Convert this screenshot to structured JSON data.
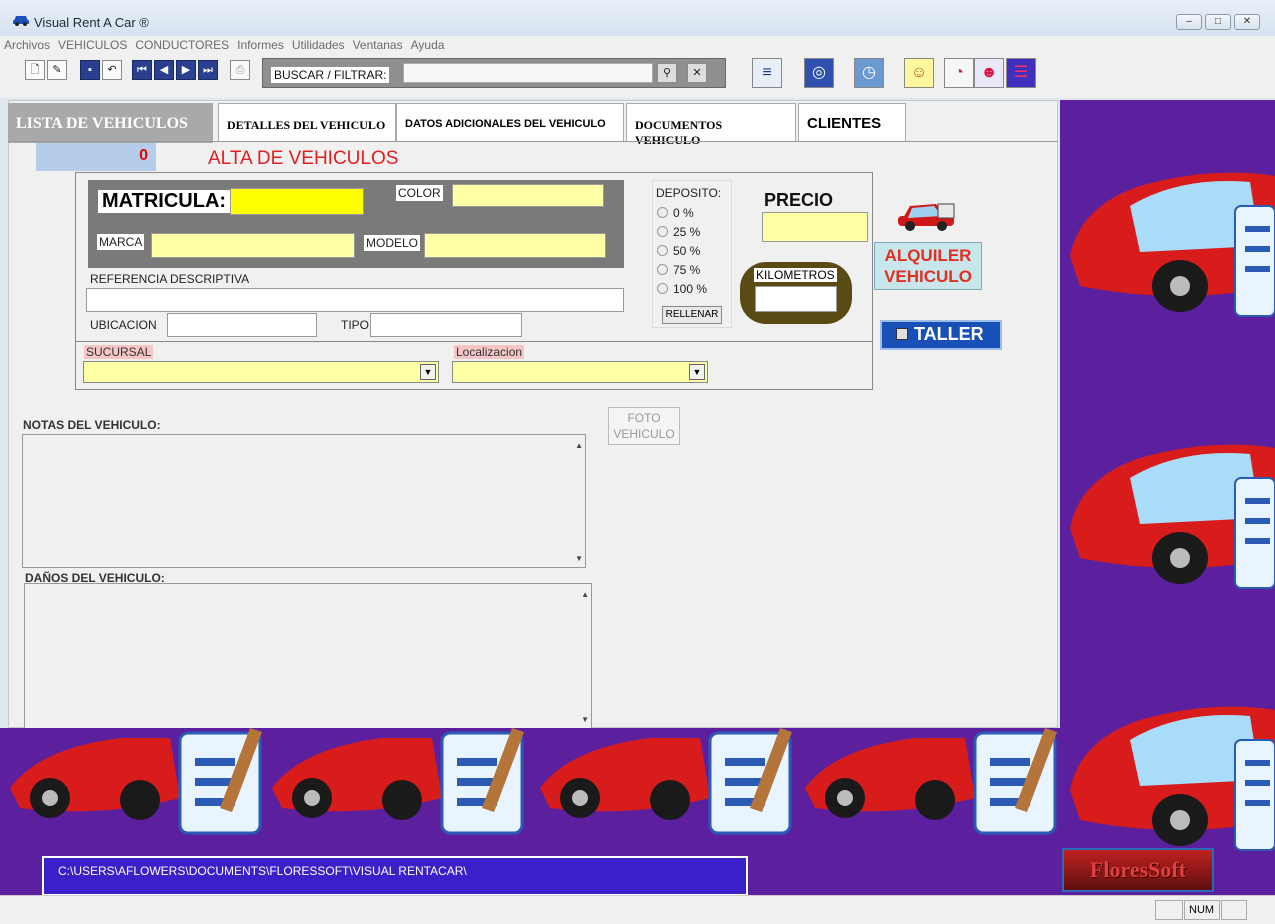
{
  "window": {
    "title": "Visual Rent A Car ®"
  },
  "menu": [
    "Archivos",
    "VEHICULOS",
    "CONDUCTORES",
    "Informes",
    "Utilidades",
    "Ventanas",
    "Ayuda"
  ],
  "toolbar": {
    "search_label": "BUSCAR / FILTRAR:",
    "search_value": ""
  },
  "tabs": {
    "list": "LISTA DE VEHICULOS",
    "details": "DETALLES DEL VEHICULO",
    "extra": "DATOS ADICIONALES DEL VEHICULO",
    "docs": "DOCUMENTOS VEHICULO",
    "clients": "CLIENTES"
  },
  "header": {
    "counter": "0",
    "mode_title": "ALTA DE VEHICULOS"
  },
  "form": {
    "matricula_label": "MATRICULA:",
    "color_label": "COLOR",
    "marca_label": "MARCA",
    "modelo_label": "MODELO",
    "referencia_label": "REFERENCIA DESCRIPTIVA",
    "ubicacion_label": "UBICACION",
    "tipo_label": "TIPO",
    "sucursal_label": "SUCURSAL",
    "localizacion_label": "Localizacion",
    "deposito_label": "DEPOSITO:",
    "deposito_options": [
      "0 %",
      "25 %",
      "50 %",
      "75 %",
      "100 %"
    ],
    "rellenar_label": "RELLENAR",
    "precio_label": "PRECIO",
    "kilometros_label": "KILOMETROS",
    "alquiler_line1": "ALQUILER",
    "alquiler_line2": "VEHICULO",
    "taller_label": "TALLER",
    "foto_line1": "FOTO",
    "foto_line2": "VEHICULO",
    "notas_label": "NOTAS DEL VEHICULO:",
    "danos_label": "DAÑOS DEL VEHICULO:"
  },
  "footer": {
    "path": "C:\\USERS\\AFLOWERS\\DOCUMENTS\\FLORESSOFT\\VISUAL RENTACAR\\",
    "logo": "FloresSoft"
  },
  "statusbar": {
    "num": "NUM"
  }
}
